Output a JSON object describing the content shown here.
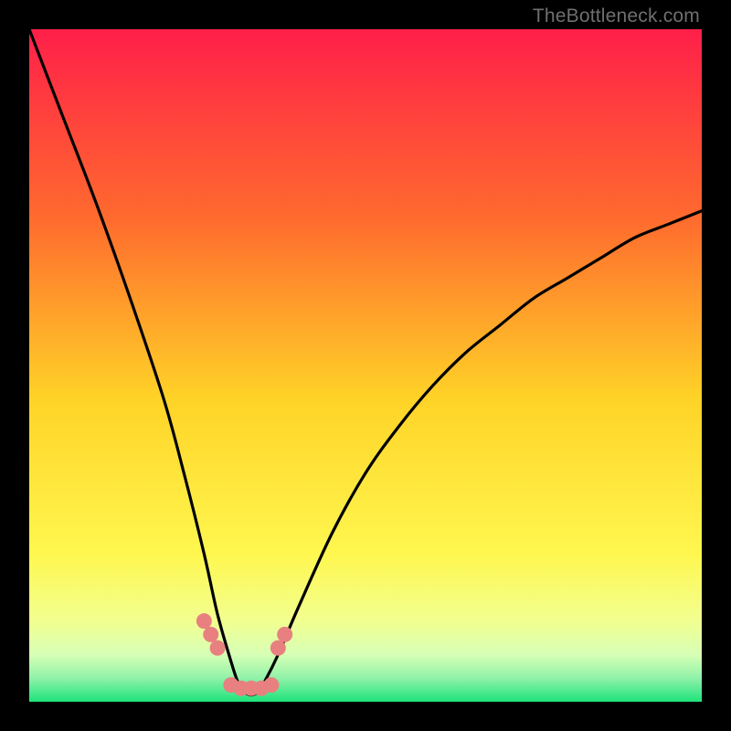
{
  "watermark": {
    "text": "TheBottleneck.com"
  },
  "colors": {
    "frame": "#000000",
    "grad_top": "#ff1f49",
    "grad_mid_upper": "#ff8a2e",
    "grad_mid": "#ffe227",
    "grad_lower": "#f6ff6e",
    "grad_pale": "#e8ffb0",
    "grad_bottom": "#1ee37b",
    "curve": "#000000",
    "markers": "#e98080"
  },
  "chart_data": {
    "type": "line",
    "title": "",
    "xlabel": "",
    "ylabel": "",
    "xlim": [
      0,
      100
    ],
    "ylim": [
      0,
      100
    ],
    "series": [
      {
        "name": "bottleneck-curve",
        "x": [
          0,
          5,
          10,
          15,
          20,
          23,
          26,
          28,
          30,
          31,
          32,
          33,
          34,
          35,
          37,
          40,
          45,
          50,
          55,
          60,
          65,
          70,
          75,
          80,
          85,
          90,
          95,
          100
        ],
        "values": [
          100,
          87,
          74,
          60,
          45,
          34,
          22,
          13,
          6,
          3,
          1.5,
          1,
          1.5,
          3,
          7,
          14,
          25,
          34,
          41,
          47,
          52,
          56,
          60,
          63,
          66,
          69,
          71,
          73
        ]
      }
    ],
    "markers": {
      "name": "highlighted-points",
      "x": [
        26,
        27,
        28,
        30,
        31.5,
        33,
        34.5,
        36,
        37,
        38
      ],
      "values": [
        12,
        10,
        8,
        2.5,
        2,
        2,
        2,
        2.5,
        8,
        10
      ]
    },
    "gradient_stops": [
      {
        "offset": 0.0,
        "color": "#ff1f49"
      },
      {
        "offset": 0.28,
        "color": "#ff6a2e"
      },
      {
        "offset": 0.55,
        "color": "#ffd327"
      },
      {
        "offset": 0.78,
        "color": "#fff74f"
      },
      {
        "offset": 0.88,
        "color": "#f2ff90"
      },
      {
        "offset": 0.93,
        "color": "#d7ffb6"
      },
      {
        "offset": 0.965,
        "color": "#8ff2a8"
      },
      {
        "offset": 1.0,
        "color": "#1ee37b"
      }
    ]
  }
}
